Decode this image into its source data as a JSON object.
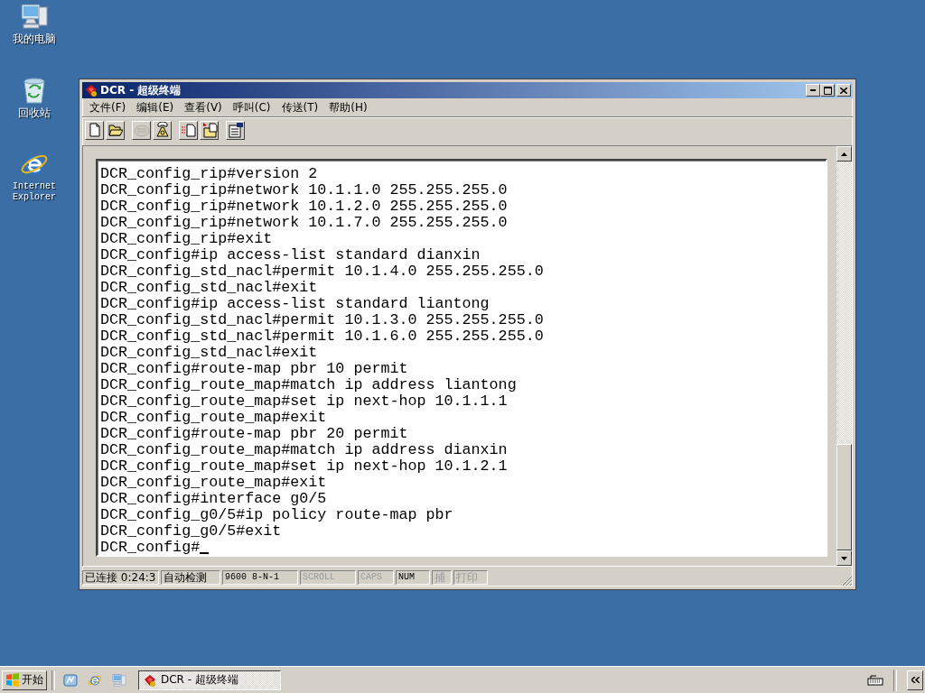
{
  "desktop_icons": [
    {
      "kind": "computer",
      "label": "我的电脑"
    },
    {
      "kind": "recycle",
      "label": "回收站"
    },
    {
      "kind": "browser",
      "label": "Internet Explorer"
    }
  ],
  "window": {
    "title": "DCR - 超级终端",
    "active": true
  },
  "menu": [
    "文件(F)",
    "编辑(E)",
    "查看(V)",
    "呼叫(C)",
    "传送(T)",
    "帮助(H)"
  ],
  "toolbar": [
    [
      {
        "kind": "new",
        "disabled": false
      },
      {
        "kind": "open",
        "disabled": false
      }
    ],
    [
      {
        "kind": "dial",
        "disabled": true
      },
      {
        "kind": "hangup",
        "disabled": false
      }
    ],
    [
      {
        "kind": "send",
        "disabled": false
      },
      {
        "kind": "receive",
        "disabled": false
      }
    ],
    [
      {
        "kind": "properties",
        "disabled": false
      }
    ]
  ],
  "terminal": {
    "lines": [
      "DCR_config_rip#version 2",
      "DCR_config_rip#network 10.1.1.0 255.255.255.0",
      "DCR_config_rip#network 10.1.2.0 255.255.255.0",
      "DCR_config_rip#network 10.1.7.0 255.255.255.0",
      "DCR_config_rip#exit",
      "DCR_config#ip access-list standard dianxin",
      "DCR_config_std_nacl#permit 10.1.4.0 255.255.255.0",
      "DCR_config_std_nacl#exit",
      "DCR_config#ip access-list standard liantong",
      "DCR_config_std_nacl#permit 10.1.3.0 255.255.255.0",
      "DCR_config_std_nacl#permit 10.1.6.0 255.255.255.0",
      "DCR_config_std_nacl#exit",
      "DCR_config#route-map pbr 10 permit",
      "DCR_config_route_map#match ip address liantong",
      "DCR_config_route_map#set ip next-hop 10.1.1.1",
      "DCR_config_route_map#exit",
      "DCR_config#route-map pbr 20 permit",
      "DCR_config_route_map#match ip address dianxin",
      "DCR_config_route_map#set ip next-hop 10.1.2.1",
      "DCR_config_route_map#exit",
      "DCR_config#interface g0/5",
      "DCR_config_g0/5#ip policy route-map pbr",
      "DCR_config_g0/5#exit",
      "DCR_config#"
    ],
    "cursor": true
  },
  "status_bar": [
    {
      "text": "已连接 0:24:3",
      "disabled": false
    },
    {
      "text": "自动检测",
      "disabled": false
    },
    {
      "text": "9600 8-N-1",
      "disabled": false
    },
    {
      "text": "SCROLL",
      "disabled": true
    },
    {
      "text": "CAPS",
      "disabled": true
    },
    {
      "text": "NUM",
      "disabled": false
    },
    {
      "text": "捕",
      "disabled": true
    },
    {
      "text": "打印",
      "disabled": true
    }
  ],
  "taskbar": {
    "start": "开始",
    "quick_launch": [
      {
        "kind": "desktop"
      },
      {
        "kind": "browser"
      },
      {
        "kind": "computer"
      }
    ],
    "tasks": [
      {
        "label": "DCR - 超级终端",
        "selected": true
      }
    ]
  }
}
